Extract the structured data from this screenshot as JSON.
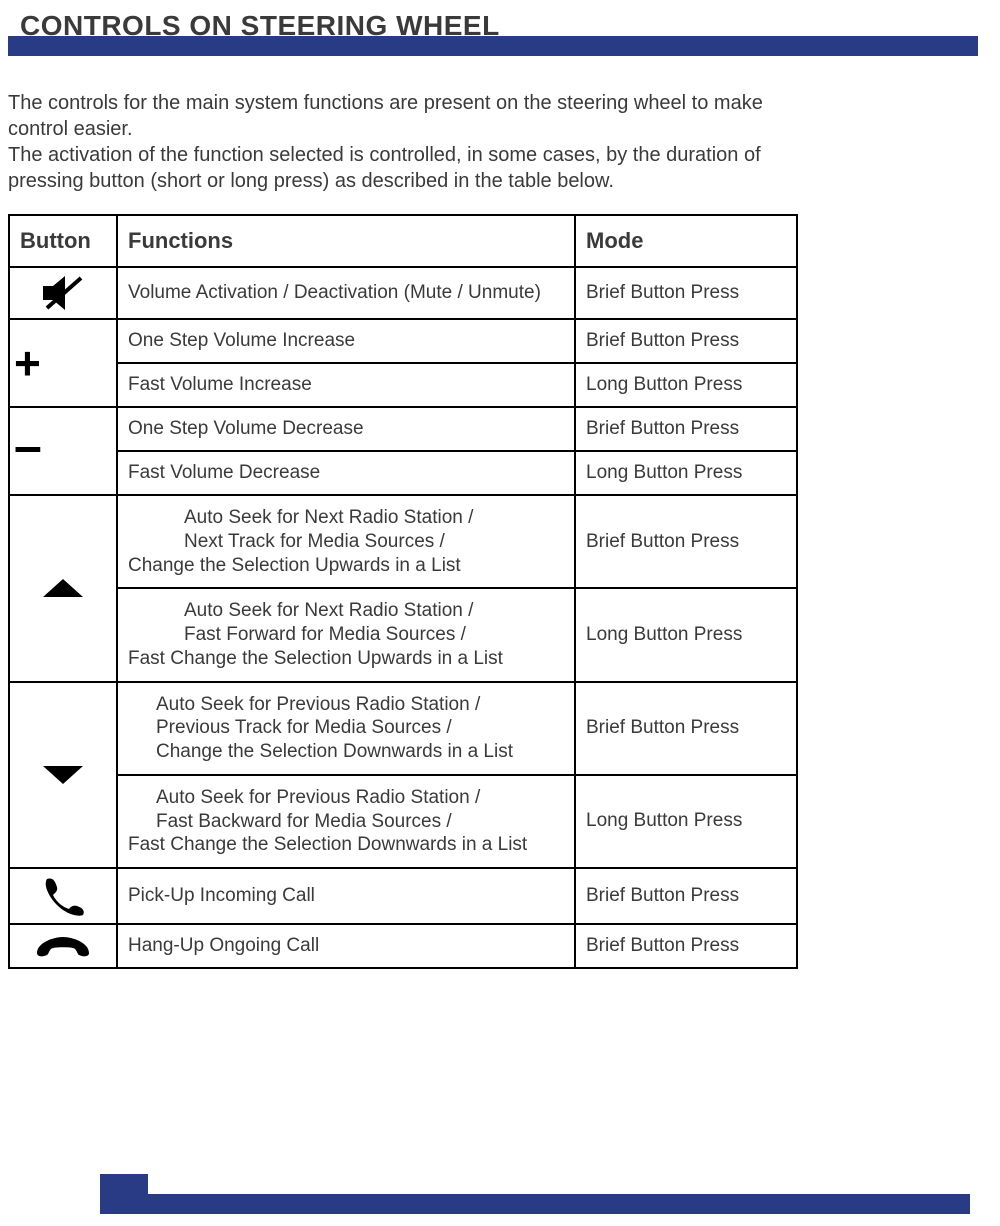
{
  "title": "CONTROLS ON STEERING WHEEL",
  "intro_p1": "The controls for the main system functions are present on the steering wheel to make control easier.",
  "intro_p2": "The activation of the function selected is controlled, in some cases, by the duration of pressing button (short or long press) as described in the table below.",
  "headers": {
    "button": "Button",
    "functions": "Functions",
    "mode": "Mode"
  },
  "rows": {
    "mute": {
      "func": "Volume Activation / Deactivation (Mute / Unmute)",
      "mode": "Brief Button Press"
    },
    "plus_brief": {
      "func": "One Step Volume Increase",
      "mode": "Brief Button Press"
    },
    "plus_long": {
      "func": "Fast Volume Increase",
      "mode": "Long Button Press"
    },
    "minus_brief": {
      "func": "One Step Volume Decrease",
      "mode": "Brief Button Press"
    },
    "minus_long": {
      "func": "Fast Volume Decrease",
      "mode": "Long Button Press"
    },
    "up_brief": {
      "l1": "Auto Seek for Next Radio Station /",
      "l2": "Next Track for Media Sources /",
      "l3": "Change the Selection Upwards in a List",
      "mode": "Brief Button Press"
    },
    "up_long": {
      "l1": "Auto Seek for Next Radio Station /",
      "l2": "Fast Forward for Media Sources /",
      "l3": "Fast Change the Selection Upwards in a List",
      "mode": "Long Button Press"
    },
    "down_brief": {
      "l1": "Auto  Seek  for  Previous  Radio  Station  /",
      "l2": "Previous   Track   for   Media   Sources   /",
      "l3": "Change the Selection Downwards in a List",
      "mode": "Brief Button Press"
    },
    "down_long": {
      "l1": "Auto  Seek  for  Previous  Radio  Station  /",
      "l2": "Fast Backward for Media Sources /",
      "l3": "Fast Change the Selection Downwards in a List",
      "mode": "Long Button Press"
    },
    "pickup": {
      "func": "Pick-Up Incoming Call",
      "mode": "Brief Button Press"
    },
    "hangup": {
      "func": "Hang-Up Ongoing Call",
      "mode": "Brief Button Press"
    }
  }
}
